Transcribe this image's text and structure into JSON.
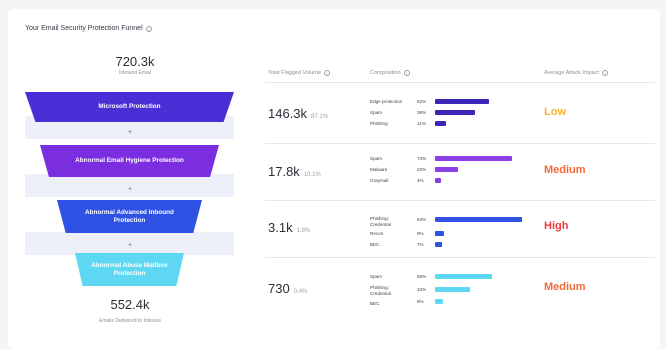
{
  "title": "Your Email Security Protection Funnel",
  "inbound": {
    "value": "720.3k",
    "label": "Inbound Email"
  },
  "delivered": {
    "value": "552.4k",
    "label": "Emails Delivered to Inboxes"
  },
  "plus_sign": "+",
  "funnel": [
    {
      "label": "Microsoft Protection",
      "color": "#4b2fd6"
    },
    {
      "label": "Abnormal Email Hygiene Protection",
      "color": "#7b2de0"
    },
    {
      "label": "Abnormal Advanced Inbound Protection",
      "color": "#2f52e4"
    },
    {
      "label": "Abnormal Abuse Mailbox Protection",
      "color": "#5ed8f2"
    }
  ],
  "columns": {
    "volume": "Total Flagged Volume",
    "composition": "Composition",
    "impact": "Average Attack Impact"
  },
  "rows": [
    {
      "volume": "146.3k",
      "volume_pct": "87.1%",
      "impact": "Low",
      "impact_color": "#f5b731",
      "items": [
        {
          "label": "Edge protection",
          "pct": "52%",
          "value": 52,
          "color": "#3a26b8"
        },
        {
          "label": "Spam",
          "pct": "38%",
          "value": 38,
          "color": "#3a26b8"
        },
        {
          "label": "Phishing",
          "pct": "11%",
          "value": 11,
          "color": "#3a26b8"
        }
      ]
    },
    {
      "volume": "17.8k",
      "volume_pct": "10.1%",
      "impact": "Medium",
      "impact_color": "#f26a3a",
      "items": [
        {
          "label": "Spam",
          "pct": "74%",
          "value": 74,
          "color": "#8a3fe6"
        },
        {
          "label": "Malware",
          "pct": "22%",
          "value": 22,
          "color": "#8a3fe6"
        },
        {
          "label": "Graymail",
          "pct": "4%",
          "value": 4,
          "color": "#8a3fe6"
        }
      ]
    },
    {
      "volume": "3.1k",
      "volume_pct": "1.8%",
      "impact": "High",
      "impact_color": "#ee3a3a",
      "items": [
        {
          "label": "Phishing: Credential",
          "pct": "84%",
          "value": 84,
          "color": "#2f52e4"
        },
        {
          "label": "Recon",
          "pct": "9%",
          "value": 9,
          "color": "#2f52e4"
        },
        {
          "label": "BEC",
          "pct": "7%",
          "value": 7,
          "color": "#2f52e4"
        }
      ]
    },
    {
      "volume": "730",
      "volume_pct": "0.4%",
      "impact": "Medium",
      "impact_color": "#f26a3a",
      "items": [
        {
          "label": "Spam",
          "pct": "55%",
          "value": 55,
          "color": "#5ed8f2"
        },
        {
          "label": "Phishing: Credential",
          "pct": "34%",
          "value": 34,
          "color": "#5ed8f2"
        },
        {
          "label": "BEC",
          "pct": "8%",
          "value": 8,
          "color": "#5ed8f2"
        }
      ]
    }
  ]
}
